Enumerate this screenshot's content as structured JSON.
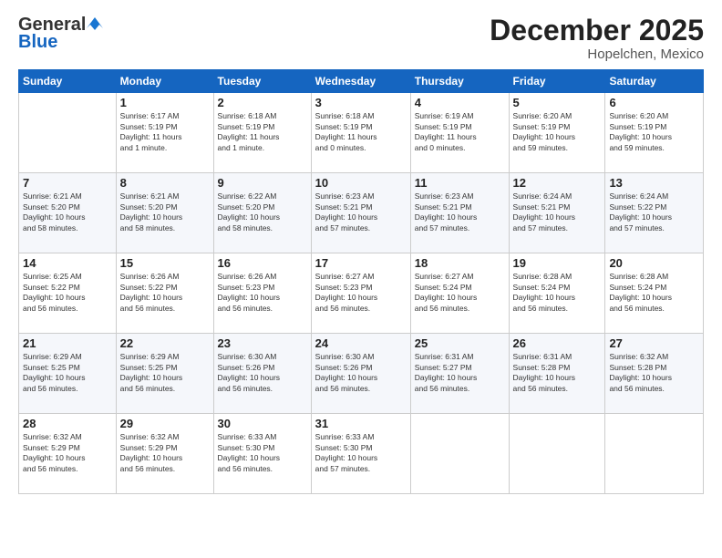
{
  "header": {
    "logo_general": "General",
    "logo_blue": "Blue",
    "month_title": "December 2025",
    "location": "Hopelchen, Mexico"
  },
  "weekdays": [
    "Sunday",
    "Monday",
    "Tuesday",
    "Wednesday",
    "Thursday",
    "Friday",
    "Saturday"
  ],
  "weeks": [
    [
      {
        "day": "",
        "info": ""
      },
      {
        "day": "1",
        "info": "Sunrise: 6:17 AM\nSunset: 5:19 PM\nDaylight: 11 hours\nand 1 minute."
      },
      {
        "day": "2",
        "info": "Sunrise: 6:18 AM\nSunset: 5:19 PM\nDaylight: 11 hours\nand 1 minute."
      },
      {
        "day": "3",
        "info": "Sunrise: 6:18 AM\nSunset: 5:19 PM\nDaylight: 11 hours\nand 0 minutes."
      },
      {
        "day": "4",
        "info": "Sunrise: 6:19 AM\nSunset: 5:19 PM\nDaylight: 11 hours\nand 0 minutes."
      },
      {
        "day": "5",
        "info": "Sunrise: 6:20 AM\nSunset: 5:19 PM\nDaylight: 10 hours\nand 59 minutes."
      },
      {
        "day": "6",
        "info": "Sunrise: 6:20 AM\nSunset: 5:19 PM\nDaylight: 10 hours\nand 59 minutes."
      }
    ],
    [
      {
        "day": "7",
        "info": "Sunrise: 6:21 AM\nSunset: 5:20 PM\nDaylight: 10 hours\nand 58 minutes."
      },
      {
        "day": "8",
        "info": "Sunrise: 6:21 AM\nSunset: 5:20 PM\nDaylight: 10 hours\nand 58 minutes."
      },
      {
        "day": "9",
        "info": "Sunrise: 6:22 AM\nSunset: 5:20 PM\nDaylight: 10 hours\nand 58 minutes."
      },
      {
        "day": "10",
        "info": "Sunrise: 6:23 AM\nSunset: 5:21 PM\nDaylight: 10 hours\nand 57 minutes."
      },
      {
        "day": "11",
        "info": "Sunrise: 6:23 AM\nSunset: 5:21 PM\nDaylight: 10 hours\nand 57 minutes."
      },
      {
        "day": "12",
        "info": "Sunrise: 6:24 AM\nSunset: 5:21 PM\nDaylight: 10 hours\nand 57 minutes."
      },
      {
        "day": "13",
        "info": "Sunrise: 6:24 AM\nSunset: 5:22 PM\nDaylight: 10 hours\nand 57 minutes."
      }
    ],
    [
      {
        "day": "14",
        "info": "Sunrise: 6:25 AM\nSunset: 5:22 PM\nDaylight: 10 hours\nand 56 minutes."
      },
      {
        "day": "15",
        "info": "Sunrise: 6:26 AM\nSunset: 5:22 PM\nDaylight: 10 hours\nand 56 minutes."
      },
      {
        "day": "16",
        "info": "Sunrise: 6:26 AM\nSunset: 5:23 PM\nDaylight: 10 hours\nand 56 minutes."
      },
      {
        "day": "17",
        "info": "Sunrise: 6:27 AM\nSunset: 5:23 PM\nDaylight: 10 hours\nand 56 minutes."
      },
      {
        "day": "18",
        "info": "Sunrise: 6:27 AM\nSunset: 5:24 PM\nDaylight: 10 hours\nand 56 minutes."
      },
      {
        "day": "19",
        "info": "Sunrise: 6:28 AM\nSunset: 5:24 PM\nDaylight: 10 hours\nand 56 minutes."
      },
      {
        "day": "20",
        "info": "Sunrise: 6:28 AM\nSunset: 5:24 PM\nDaylight: 10 hours\nand 56 minutes."
      }
    ],
    [
      {
        "day": "21",
        "info": "Sunrise: 6:29 AM\nSunset: 5:25 PM\nDaylight: 10 hours\nand 56 minutes."
      },
      {
        "day": "22",
        "info": "Sunrise: 6:29 AM\nSunset: 5:25 PM\nDaylight: 10 hours\nand 56 minutes."
      },
      {
        "day": "23",
        "info": "Sunrise: 6:30 AM\nSunset: 5:26 PM\nDaylight: 10 hours\nand 56 minutes."
      },
      {
        "day": "24",
        "info": "Sunrise: 6:30 AM\nSunset: 5:26 PM\nDaylight: 10 hours\nand 56 minutes."
      },
      {
        "day": "25",
        "info": "Sunrise: 6:31 AM\nSunset: 5:27 PM\nDaylight: 10 hours\nand 56 minutes."
      },
      {
        "day": "26",
        "info": "Sunrise: 6:31 AM\nSunset: 5:28 PM\nDaylight: 10 hours\nand 56 minutes."
      },
      {
        "day": "27",
        "info": "Sunrise: 6:32 AM\nSunset: 5:28 PM\nDaylight: 10 hours\nand 56 minutes."
      }
    ],
    [
      {
        "day": "28",
        "info": "Sunrise: 6:32 AM\nSunset: 5:29 PM\nDaylight: 10 hours\nand 56 minutes."
      },
      {
        "day": "29",
        "info": "Sunrise: 6:32 AM\nSunset: 5:29 PM\nDaylight: 10 hours\nand 56 minutes."
      },
      {
        "day": "30",
        "info": "Sunrise: 6:33 AM\nSunset: 5:30 PM\nDaylight: 10 hours\nand 56 minutes."
      },
      {
        "day": "31",
        "info": "Sunrise: 6:33 AM\nSunset: 5:30 PM\nDaylight: 10 hours\nand 57 minutes."
      },
      {
        "day": "",
        "info": ""
      },
      {
        "day": "",
        "info": ""
      },
      {
        "day": "",
        "info": ""
      }
    ]
  ]
}
